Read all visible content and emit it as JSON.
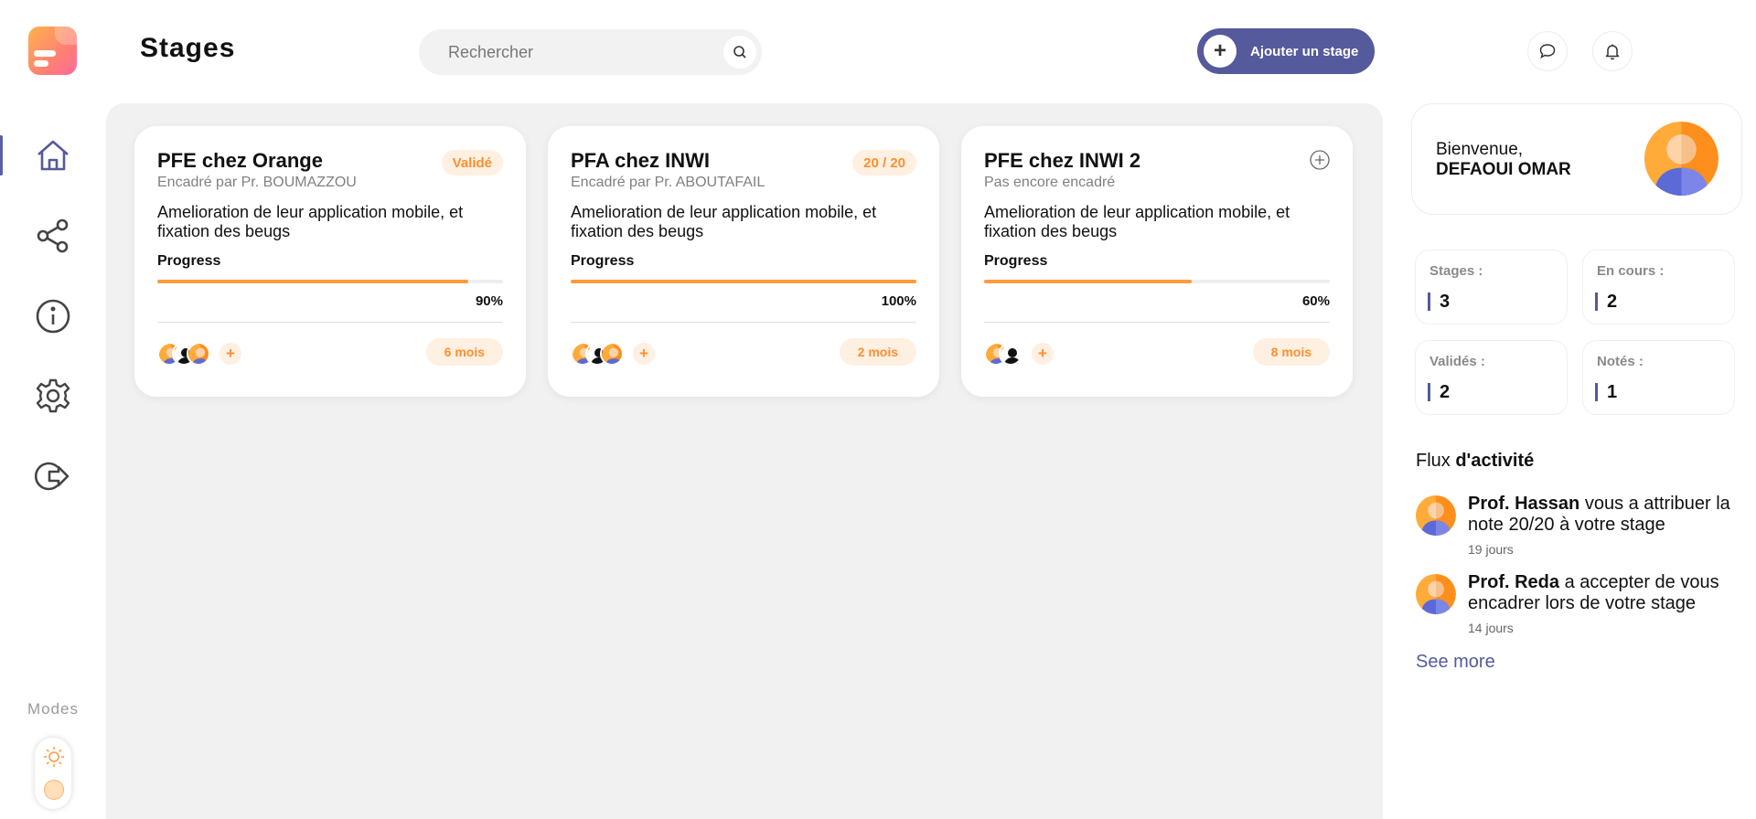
{
  "header": {
    "title": "Stages",
    "search_placeholder": "Rechercher",
    "add_label": "Ajouter un stage"
  },
  "sidebar": {
    "items": [
      {
        "name": "home",
        "active": true
      },
      {
        "name": "share",
        "active": false
      },
      {
        "name": "info",
        "active": false
      },
      {
        "name": "settings",
        "active": false
      },
      {
        "name": "logout",
        "active": false
      }
    ],
    "modes_label": "Modes"
  },
  "cards": [
    {
      "title": "PFE chez Orange",
      "supervisor": "Encadré par Pr. BOUMAZZOU",
      "badge": "Validé",
      "description": "Amelioration de leur application mobile, et fixation des beugs",
      "progress_label": "Progress",
      "progress": 0.9,
      "progress_text": "90%",
      "duration": "6 mois"
    },
    {
      "title": "PFA chez INWI",
      "supervisor": "Encadré par Pr. ABOUTAFAIL",
      "badge": "20 / 20",
      "description": "Amelioration de leur application mobile, et fixation des beugs",
      "progress_label": "Progress",
      "progress": 1.0,
      "progress_text": "100%",
      "duration": "2 mois"
    },
    {
      "title": "PFE chez INWI 2",
      "supervisor": "Pas encore encadré",
      "badge": "",
      "description": "Amelioration de leur application mobile, et fixation des beugs",
      "progress_label": "Progress",
      "progress": 0.6,
      "progress_text": "60%",
      "duration": "8 mois"
    }
  ],
  "profile": {
    "greeting": "Bienvenue,",
    "name": "DEFAOUI OMAR"
  },
  "stats": [
    {
      "label": "Stages :",
      "value": "3"
    },
    {
      "label": "En cours :",
      "value": "2"
    },
    {
      "label": "Validés :",
      "value": "2"
    },
    {
      "label": "Notés :",
      "value": "1"
    }
  ],
  "activity": {
    "title_prefix": "Flux ",
    "title_bold": "d'activité",
    "items": [
      {
        "author": "Prof. Hassan",
        "text": " vous a attribuer la note 20/20 à votre stage",
        "time": "19 jours"
      },
      {
        "author": "Prof. Reda",
        "text": " a accepter de vous encadrer lors de votre stage",
        "time": "14 jours"
      }
    ],
    "see_more": "See more"
  },
  "colors": {
    "accent": "#545a9c",
    "orange": "#ff9a3d",
    "badge_bg": "#fff0e2"
  }
}
